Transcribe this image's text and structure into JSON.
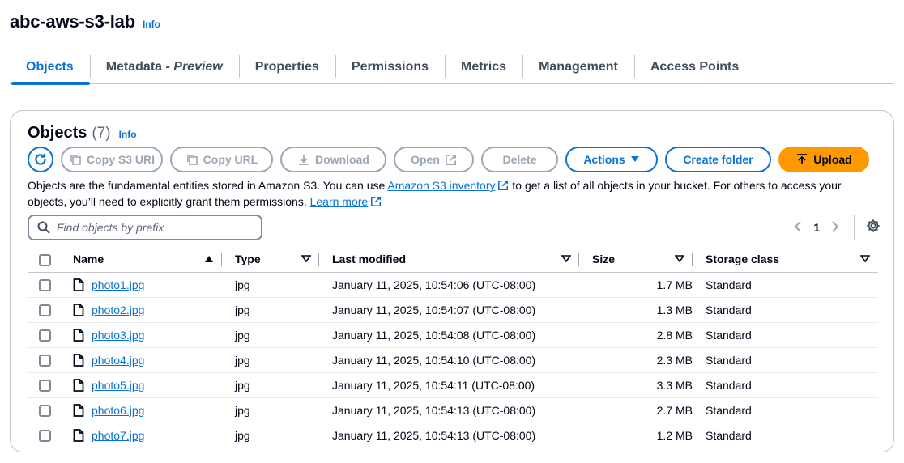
{
  "bucket": {
    "name": "abc-aws-s3-lab",
    "info": "Info"
  },
  "tabs": [
    {
      "label": "Objects"
    },
    {
      "label": "Metadata - ",
      "suffix": "Preview"
    },
    {
      "label": "Properties"
    },
    {
      "label": "Permissions"
    },
    {
      "label": "Metrics"
    },
    {
      "label": "Management"
    },
    {
      "label": "Access Points"
    }
  ],
  "panel": {
    "title": "Objects",
    "count": "(7)",
    "info": "Info",
    "toolbar": {
      "copy_s3_uri": "Copy S3 URI",
      "copy_url": "Copy URL",
      "download": "Download",
      "open": "Open",
      "delete": "Delete",
      "actions": "Actions",
      "create_folder": "Create folder",
      "upload": "Upload"
    },
    "description": {
      "part1": "Objects are the fundamental entities stored in Amazon S3. You can use ",
      "link1": "Amazon S3 inventory",
      "part2": " to get a list of all objects in your bucket. For others to access your objects, you’ll need to explicitly grant them permissions. ",
      "link2": "Learn more"
    },
    "search": {
      "placeholder": "Find objects by prefix"
    },
    "pagination": {
      "page": "1"
    }
  },
  "table": {
    "columns": {
      "name": "Name",
      "type": "Type",
      "last_modified": "Last modified",
      "size": "Size",
      "storage_class": "Storage class"
    },
    "rows": [
      {
        "name": "photo1.jpg",
        "type": "jpg",
        "modified": "January 11, 2025, 10:54:06 (UTC-08:00)",
        "size": "1.7 MB",
        "storage": "Standard"
      },
      {
        "name": "photo2.jpg",
        "type": "jpg",
        "modified": "January 11, 2025, 10:54:07 (UTC-08:00)",
        "size": "1.3 MB",
        "storage": "Standard"
      },
      {
        "name": "photo3.jpg",
        "type": "jpg",
        "modified": "January 11, 2025, 10:54:08 (UTC-08:00)",
        "size": "2.8 MB",
        "storage": "Standard"
      },
      {
        "name": "photo4.jpg",
        "type": "jpg",
        "modified": "January 11, 2025, 10:54:10 (UTC-08:00)",
        "size": "2.3 MB",
        "storage": "Standard"
      },
      {
        "name": "photo5.jpg",
        "type": "jpg",
        "modified": "January 11, 2025, 10:54:11 (UTC-08:00)",
        "size": "3.3 MB",
        "storage": "Standard"
      },
      {
        "name": "photo6.jpg",
        "type": "jpg",
        "modified": "January 11, 2025, 10:54:13 (UTC-08:00)",
        "size": "2.7 MB",
        "storage": "Standard"
      },
      {
        "name": "photo7.jpg",
        "type": "jpg",
        "modified": "January 11, 2025, 10:54:13 (UTC-08:00)",
        "size": "1.2 MB",
        "storage": "Standard"
      }
    ]
  },
  "colors": {
    "link": "#0972d3",
    "upload": "#ff9900",
    "disabled": "#9ba7b6",
    "text": "#000716"
  }
}
